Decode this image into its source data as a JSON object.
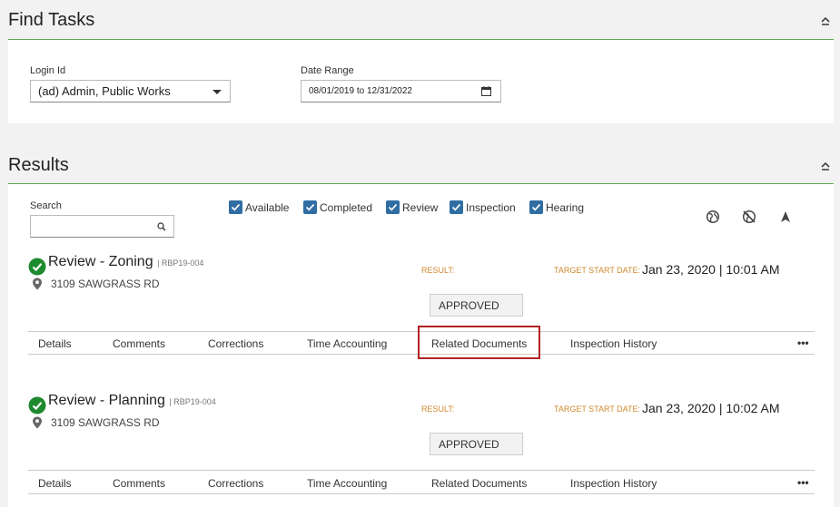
{
  "find_tasks": {
    "title": "Find Tasks",
    "login_label": "Login Id",
    "login_value": "(ad) Admin, Public Works",
    "date_label": "Date Range",
    "date_value": "08/01/2019 to 12/31/2022"
  },
  "results": {
    "title": "Results",
    "search_label": "Search",
    "search_value": "",
    "filters": [
      "Available",
      "Completed",
      "Review",
      "Inspection",
      "Hearing"
    ],
    "tools": [
      "globe-icon",
      "globe-off-icon",
      "navigation-arrow-icon"
    ]
  },
  "tasks": [
    {
      "title": "Review - Zoning",
      "code": "| RBP19-004",
      "address": "3109 SAWGRASS RD",
      "result_label": "RESULT:",
      "result_value": "APPROVED",
      "target_label": "TARGET START DATE:",
      "target_value": "Jan 23, 2020 | 10:01 AM"
    },
    {
      "title": "Review - Planning",
      "code": "| RBP19-004",
      "address": "3109 SAWGRASS RD",
      "result_label": "RESULT:",
      "result_value": "APPROVED",
      "target_label": "TARGET START DATE:",
      "target_value": "Jan 23, 2020 | 10:02 AM"
    }
  ],
  "task_tabs": [
    "Details",
    "Comments",
    "Corrections",
    "Time Accounting",
    "Related Documents",
    "Inspection History"
  ],
  "more_label": "•••",
  "colors": {
    "accent_green": "#5cab4a",
    "checkbox_blue": "#2f6da3",
    "status_green": "#1e8a2f",
    "label_orange": "#d08a2e",
    "highlight_red": "#b22222"
  }
}
